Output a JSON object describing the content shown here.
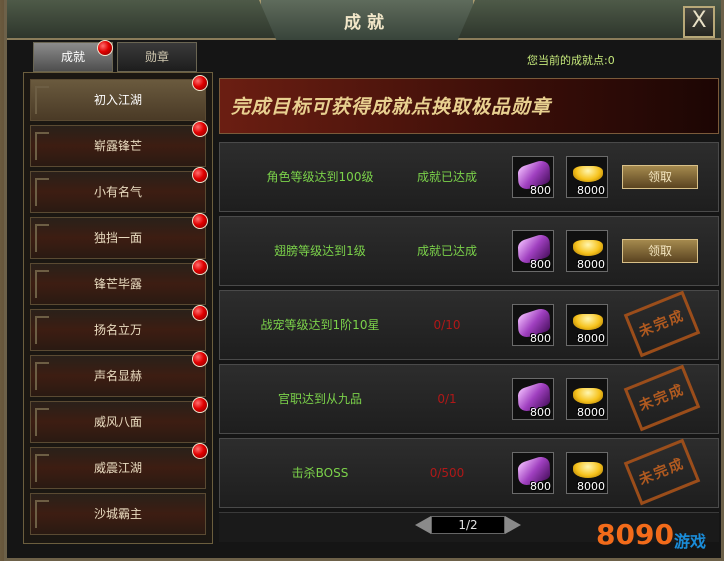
{
  "window": {
    "title": "成就",
    "close_label": "X"
  },
  "tabs": [
    {
      "label": "成就",
      "active": true
    },
    {
      "label": "勋章",
      "active": false
    }
  ],
  "points_text": "您当前的成就点:0",
  "banner_text": "完成目标可获得成就点换取极品勋章",
  "categories": [
    {
      "label": "初入江湖",
      "selected": true
    },
    {
      "label": "崭露锋芒"
    },
    {
      "label": "小有名气"
    },
    {
      "label": "独挡一面"
    },
    {
      "label": "锋芒毕露"
    },
    {
      "label": "扬名立万"
    },
    {
      "label": "声名显赫"
    },
    {
      "label": "威风八面"
    },
    {
      "label": "威震江湖"
    },
    {
      "label": "沙城霸主"
    }
  ],
  "achievements": [
    {
      "name": "角色等级达到100级",
      "status": "成就已达成",
      "reward1": "800",
      "reward2": "8000",
      "action": "领取"
    },
    {
      "name": "翅膀等级达到1级",
      "status": "成就已达成",
      "reward1": "800",
      "reward2": "8000",
      "action": "领取"
    },
    {
      "name": "战宠等级达到1阶10星",
      "status": "0/10",
      "reward1": "800",
      "reward2": "8000",
      "stamp": "未完成"
    },
    {
      "name": "官职达到从九品",
      "status": "0/1",
      "reward1": "800",
      "reward2": "8000",
      "stamp": "未完成"
    },
    {
      "name": "击杀BOSS",
      "status": "0/500",
      "reward1": "800",
      "reward2": "8000",
      "stamp": "未完成"
    }
  ],
  "pager": {
    "text": "1/2"
  },
  "watermark": {
    "number": "8090",
    "text": "游戏"
  },
  "colors": {
    "accent_green": "#7bd24a",
    "progress_red": "#b01818",
    "stamp_orange": "#c06020"
  }
}
